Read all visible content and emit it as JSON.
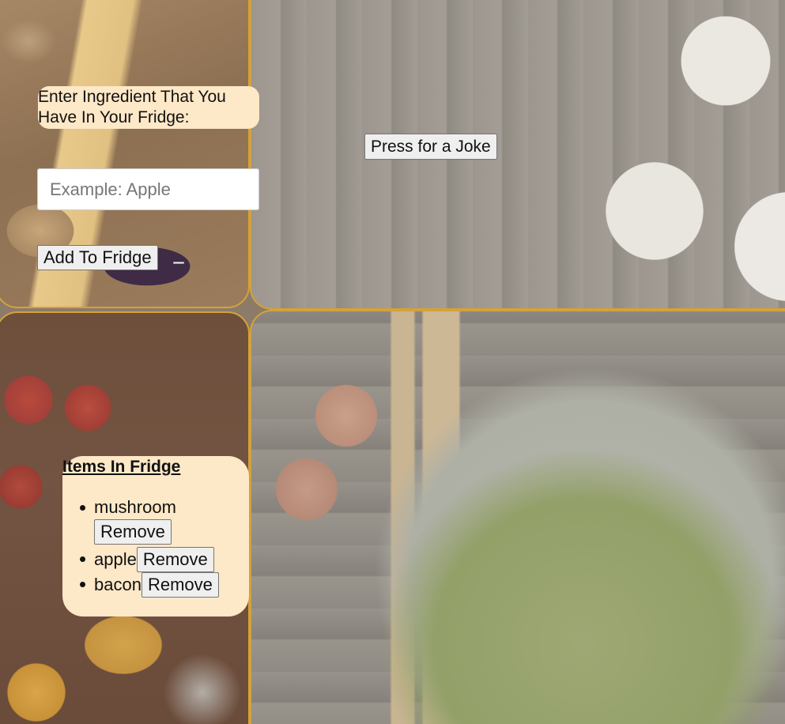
{
  "ingredient_form": {
    "prompt_label": "Enter Ingredient That You Have In Your Fridge:",
    "input_value": "",
    "input_placeholder": "Example: Apple",
    "add_button_label": "Add To Fridge"
  },
  "joke": {
    "button_label": "Press for a Joke"
  },
  "fridge": {
    "title": "Items In Fridge",
    "items": [
      {
        "name": "mushroom",
        "remove_label": "Remove"
      },
      {
        "name": "apple",
        "remove_label": "Remove"
      },
      {
        "name": "bacon",
        "remove_label": "Remove"
      }
    ]
  },
  "colors": {
    "label_background": "#fde8c7",
    "panel_border": "#d4a23a"
  }
}
